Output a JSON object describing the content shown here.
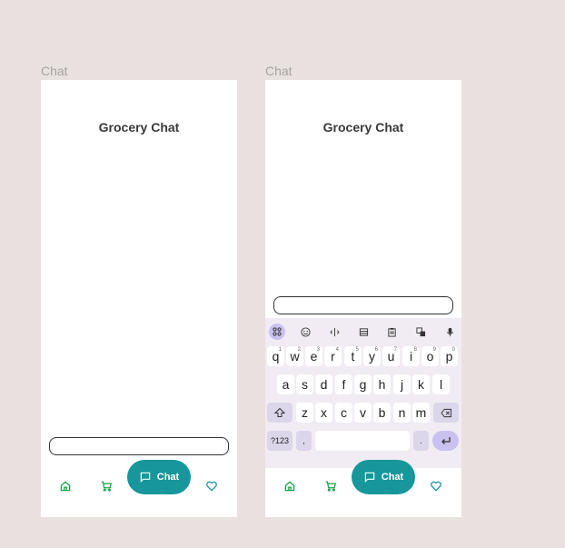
{
  "frames": [
    {
      "label": "Chat",
      "title": "Grocery Chat",
      "nav": {
        "home": "home-icon",
        "cart": "cart-icon",
        "chat_label": "Chat",
        "favorites": "heart-icon"
      }
    },
    {
      "label": "Chat",
      "title": "Grocery Chat",
      "nav": {
        "home": "home-icon",
        "cart": "cart-icon",
        "chat_label": "Chat",
        "favorites": "heart-icon"
      },
      "keyboard": {
        "row1": [
          {
            "k": "q",
            "n": "1"
          },
          {
            "k": "w",
            "n": "2"
          },
          {
            "k": "e",
            "n": "3"
          },
          {
            "k": "r",
            "n": "4"
          },
          {
            "k": "t",
            "n": "5"
          },
          {
            "k": "y",
            "n": "6"
          },
          {
            "k": "u",
            "n": "7"
          },
          {
            "k": "i",
            "n": "8"
          },
          {
            "k": "o",
            "n": "9"
          },
          {
            "k": "p",
            "n": "0"
          }
        ],
        "row2": [
          "a",
          "s",
          "d",
          "f",
          "g",
          "h",
          "j",
          "k",
          "l"
        ],
        "row3": [
          "z",
          "x",
          "c",
          "v",
          "b",
          "n",
          "m"
        ],
        "symbols_key": "?123",
        "comma_key": ",",
        "period_key": "."
      }
    }
  ],
  "colors": {
    "accent": "#17969b",
    "nav_icon": "#16a34a",
    "background": "#e9e1df"
  }
}
